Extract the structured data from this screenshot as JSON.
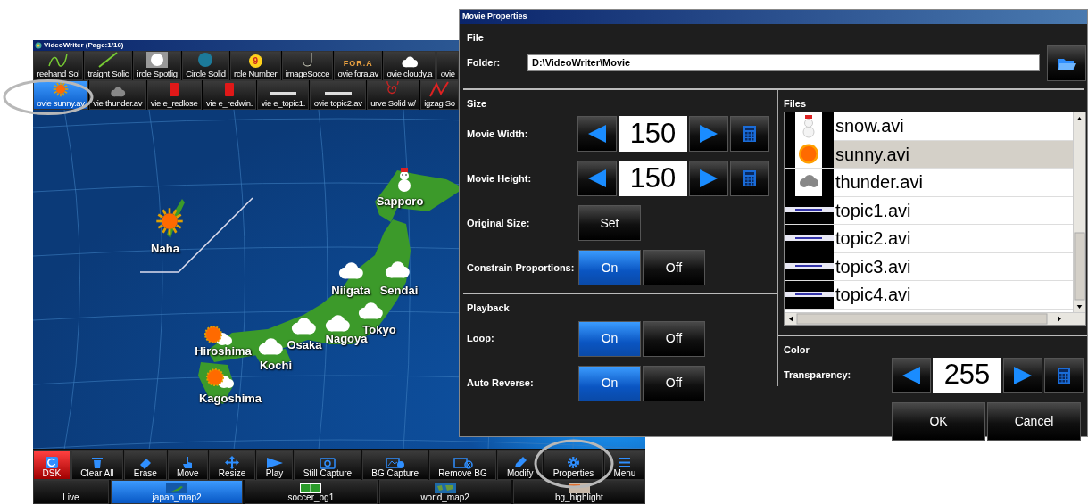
{
  "app_window": {
    "title": "VideoWriter (Page:1/16)",
    "clip_rows": [
      [
        {
          "label": "reehand Sol",
          "kind": "curve",
          "selected": false
        },
        {
          "label": "traight Solic",
          "kind": "line",
          "selected": false
        },
        {
          "label": "ircle Spotlig",
          "kind": "spotlight",
          "selected": false
        },
        {
          "label": "Circle Solid",
          "kind": "circle",
          "selected": false
        },
        {
          "label": "rcle Number",
          "kind": "number",
          "badge": "9",
          "selected": false
        },
        {
          "label": "imageSocce",
          "kind": "hook",
          "selected": false
        },
        {
          "label": "ovie fora.av",
          "kind": "logo",
          "logo": "FOR.A",
          "selected": false
        },
        {
          "label": "ovie cloudy.a",
          "kind": "cloud",
          "selected": false
        },
        {
          "label": "ovie",
          "kind": "blank",
          "selected": false
        }
      ],
      [
        {
          "label": "ovie sunny.av",
          "kind": "sun",
          "selected": true
        },
        {
          "label": "vie thunder.av",
          "kind": "graycloud",
          "selected": false
        },
        {
          "label": "vie e_redlose",
          "kind": "card",
          "selected": false
        },
        {
          "label": "vie e_redwin.",
          "kind": "card",
          "selected": false
        },
        {
          "label": "vie e_topic1.",
          "kind": "bar",
          "selected": false
        },
        {
          "label": "ovie topic2.av",
          "kind": "bar",
          "selected": false
        },
        {
          "label": "urve Solid w/",
          "kind": "spiral",
          "selected": false
        },
        {
          "label": "igzag So",
          "kind": "zigzag",
          "selected": false
        }
      ]
    ],
    "map": {
      "cities": [
        {
          "name": "Sapporo",
          "kind": "snow"
        },
        {
          "name": "Naha",
          "kind": "sun"
        },
        {
          "name": "Niigata",
          "kind": "cloud"
        },
        {
          "name": "Sendai",
          "kind": "cloud"
        },
        {
          "name": "Tokyo",
          "kind": "cloud"
        },
        {
          "name": "Nagoya",
          "kind": "cloud"
        },
        {
          "name": "Osaka",
          "kind": "cloud"
        },
        {
          "name": "Kochi",
          "kind": "cloud"
        },
        {
          "name": "Hiroshima",
          "kind": "sunandcloud"
        },
        {
          "name": "Kagoshima",
          "kind": "sunandcloud"
        }
      ]
    },
    "toolbar": [
      {
        "label": "DSK",
        "kind": "refresh",
        "active": true
      },
      {
        "label": "Clear All",
        "kind": "trash",
        "active": false
      },
      {
        "label": "Erase",
        "kind": "eraser",
        "active": false
      },
      {
        "label": "Move",
        "kind": "hand",
        "active": false
      },
      {
        "label": "Resize",
        "kind": "arrows",
        "active": false
      },
      {
        "label": "Play",
        "kind": "play",
        "active": false
      },
      {
        "label": "Still Capture",
        "kind": "camera",
        "active": false
      },
      {
        "label": "BG Capture",
        "kind": "bgcamera",
        "active": false
      },
      {
        "label": "Remove BG",
        "kind": "removebg",
        "active": false
      },
      {
        "label": "Modify",
        "kind": "pencil",
        "active": false
      },
      {
        "label": "Properties",
        "kind": "gear",
        "active": false
      },
      {
        "label": "Menu",
        "kind": "menu",
        "active": false
      }
    ],
    "backgrounds": [
      {
        "label": "Live",
        "kind": "none",
        "selected": false
      },
      {
        "label": "japan_map2",
        "kind": "japan",
        "selected": true
      },
      {
        "label": "soccer_bg1",
        "kind": "soccer",
        "selected": false
      },
      {
        "label": "world_map2",
        "kind": "world",
        "selected": false
      },
      {
        "label": "bg_highlight",
        "kind": "photo",
        "selected": false
      }
    ]
  },
  "dialog": {
    "title": "Movie Properties",
    "file": {
      "heading": "File",
      "folder": {
        "label": "Folder:",
        "value": "D:\\VideoWriter\\Movie"
      }
    },
    "size": {
      "heading": "Size",
      "width": {
        "label": "Movie Width:",
        "value": "150"
      },
      "height": {
        "label": "Movie Height:",
        "value": "150"
      },
      "original_size": {
        "label": "Original Size:",
        "button": "Set"
      },
      "constrain": {
        "label": "Constrain Proportions:",
        "options": [
          {
            "label": "On",
            "selected": true
          },
          {
            "label": "Off",
            "selected": false
          }
        ]
      }
    },
    "playback": {
      "heading": "Playback",
      "loop": {
        "label": "Loop:",
        "options": [
          {
            "label": "On",
            "selected": true
          },
          {
            "label": "Off",
            "selected": false
          }
        ]
      },
      "auto_reverse": {
        "label": "Auto Reverse:",
        "options": [
          {
            "label": "On",
            "selected": true
          },
          {
            "label": "Off",
            "selected": false
          }
        ]
      }
    },
    "files": {
      "heading": "Files",
      "items": [
        {
          "name": "snow.avi",
          "kind": "snowman",
          "selected": false
        },
        {
          "name": "sunny.avi",
          "kind": "sun",
          "selected": true
        },
        {
          "name": "thunder.avi",
          "kind": "cloud",
          "selected": false
        },
        {
          "name": "topic1.avi",
          "kind": "topic",
          "selected": false
        },
        {
          "name": "topic2.avi",
          "kind": "topic",
          "selected": false
        },
        {
          "name": "topic3.avi",
          "kind": "topic",
          "selected": false
        },
        {
          "name": "topic4.avi",
          "kind": "topic",
          "selected": false
        }
      ]
    },
    "color": {
      "heading": "Color",
      "transparency": {
        "label": "Transparency:",
        "value": "255"
      }
    },
    "buttons": [
      "OK",
      "Cancel"
    ]
  }
}
